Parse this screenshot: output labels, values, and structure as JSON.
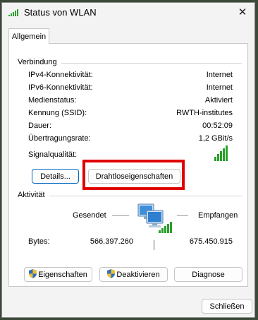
{
  "window": {
    "title": "Status von WLAN",
    "close_glyph": "✕"
  },
  "tabs": [
    {
      "label": "Allgemein",
      "selected": true
    }
  ],
  "connection": {
    "section_title": "Verbindung",
    "rows": [
      {
        "label": "IPv4-Konnektivität:",
        "value": "Internet"
      },
      {
        "label": "IPv6-Konnektivität:",
        "value": "Internet"
      },
      {
        "label": "Medienstatus:",
        "value": "Aktiviert"
      },
      {
        "label": "Kennung (SSID):",
        "value": "RWTH-institutes"
      },
      {
        "label": "Dauer:",
        "value": "00:52:09"
      },
      {
        "label": "Übertragungsrate:",
        "value": "1,2 GBit/s"
      }
    ],
    "signal_label": "Signalqualität:",
    "signal_bars_filled": 5,
    "signal_bars_total": 5,
    "details_button": "Details...",
    "wireless_button": "Drahtloseigenschaften"
  },
  "activity": {
    "section_title": "Aktivität",
    "sent_label": "Gesendet",
    "received_label": "Empfangen",
    "bytes_label": "Bytes:",
    "bytes_sent": "566.397.260",
    "bytes_received": "675.450.915"
  },
  "actions": {
    "properties_button": "Eigenschaften",
    "disable_button": "Deaktivieren",
    "diagnose_button": "Diagnose"
  },
  "footer": {
    "close_button": "Schließen"
  },
  "colors": {
    "signal_green": "#2aa02a",
    "highlight_red": "#e00000",
    "primary_border": "#0067c0"
  },
  "icons": [
    "wifi-signal-icon",
    "close-icon",
    "network-computers-icon",
    "shield-icon"
  ]
}
